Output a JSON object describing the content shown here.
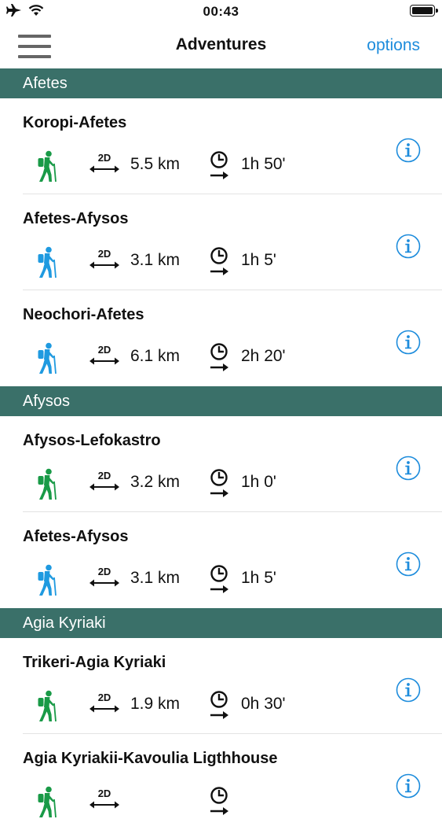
{
  "status_bar": {
    "time": "00:43"
  },
  "nav": {
    "title": "Adventures",
    "options_label": "options"
  },
  "sections": [
    {
      "title": "Afetes",
      "items": [
        {
          "name": "Koropi-Afetes",
          "distance": "5.5 km",
          "duration": "1h 50'",
          "icon_color": "#199a47"
        },
        {
          "name": "Afetes-Afysos",
          "distance": "3.1 km",
          "duration": "1h 5'",
          "icon_color": "#1f9ae0"
        },
        {
          "name": "Neochori-Afetes",
          "distance": "6.1 km",
          "duration": "2h 20'",
          "icon_color": "#1f9ae0"
        }
      ]
    },
    {
      "title": "Afysos",
      "items": [
        {
          "name": "Afysos-Lefokastro",
          "distance": "3.2 km",
          "duration": "1h 0'",
          "icon_color": "#199a47"
        },
        {
          "name": "Afetes-Afysos",
          "distance": "3.1 km",
          "duration": "1h 5'",
          "icon_color": "#1f9ae0"
        }
      ]
    },
    {
      "title": "Agia Kyriaki",
      "items": [
        {
          "name": "Trikeri-Agia Kyriaki",
          "distance": "1.9 km",
          "duration": "0h 30'",
          "icon_color": "#199a47"
        },
        {
          "name": "Agia Kyriakii-Kavoulia Ligthhouse",
          "distance": "",
          "duration": "",
          "icon_color": "#199a47"
        }
      ]
    }
  ],
  "icons": {
    "distance_label": "2D",
    "accent": "#1d8cdc",
    "header_bg": "#3a7069"
  }
}
